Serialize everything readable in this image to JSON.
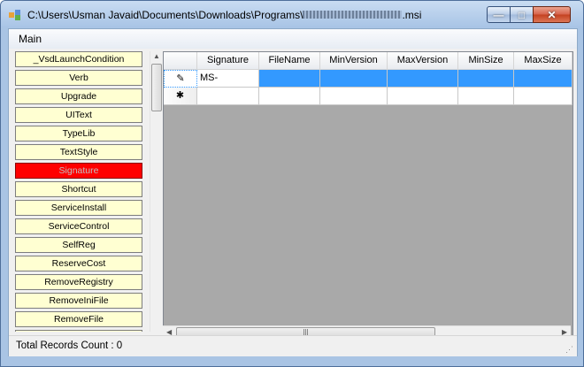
{
  "window": {
    "title_prefix": "C:\\Users\\Usman Javaid\\Documents\\Downloads\\Programs\\",
    "title_suffix": ".msi",
    "controls": {
      "minimize": "—",
      "maximize": "□",
      "close": "✕"
    }
  },
  "menu": {
    "main": "Main"
  },
  "sidebar": {
    "items": [
      {
        "label": "_VsdLaunchCondition",
        "active": false
      },
      {
        "label": "Verb",
        "active": false
      },
      {
        "label": "Upgrade",
        "active": false
      },
      {
        "label": "UIText",
        "active": false
      },
      {
        "label": "TypeLib",
        "active": false
      },
      {
        "label": "TextStyle",
        "active": false
      },
      {
        "label": "Signature",
        "active": true
      },
      {
        "label": "Shortcut",
        "active": false
      },
      {
        "label": "ServiceInstall",
        "active": false
      },
      {
        "label": "ServiceControl",
        "active": false
      },
      {
        "label": "SelfReg",
        "active": false
      },
      {
        "label": "ReserveCost",
        "active": false
      },
      {
        "label": "RemoveRegistry",
        "active": false
      },
      {
        "label": "RemoveIniFile",
        "active": false
      },
      {
        "label": "RemoveFile",
        "active": false
      }
    ]
  },
  "grid": {
    "columns": [
      "Signature",
      "FileName",
      "MinVersion",
      "MaxVersion",
      "MinSize",
      "MaxSize"
    ],
    "rows": [
      {
        "indicator": "✎",
        "cells": [
          "MS-",
          "",
          "",
          "",
          "",
          ""
        ]
      },
      {
        "indicator": "✱",
        "cells": [
          "",
          "",
          "",
          "",
          "",
          ""
        ]
      }
    ]
  },
  "status": {
    "text": "Total Records Count : 0"
  },
  "colors": {
    "active_item": "#ff0000",
    "item_bg": "#ffffd2",
    "selection": "#3399ff"
  }
}
